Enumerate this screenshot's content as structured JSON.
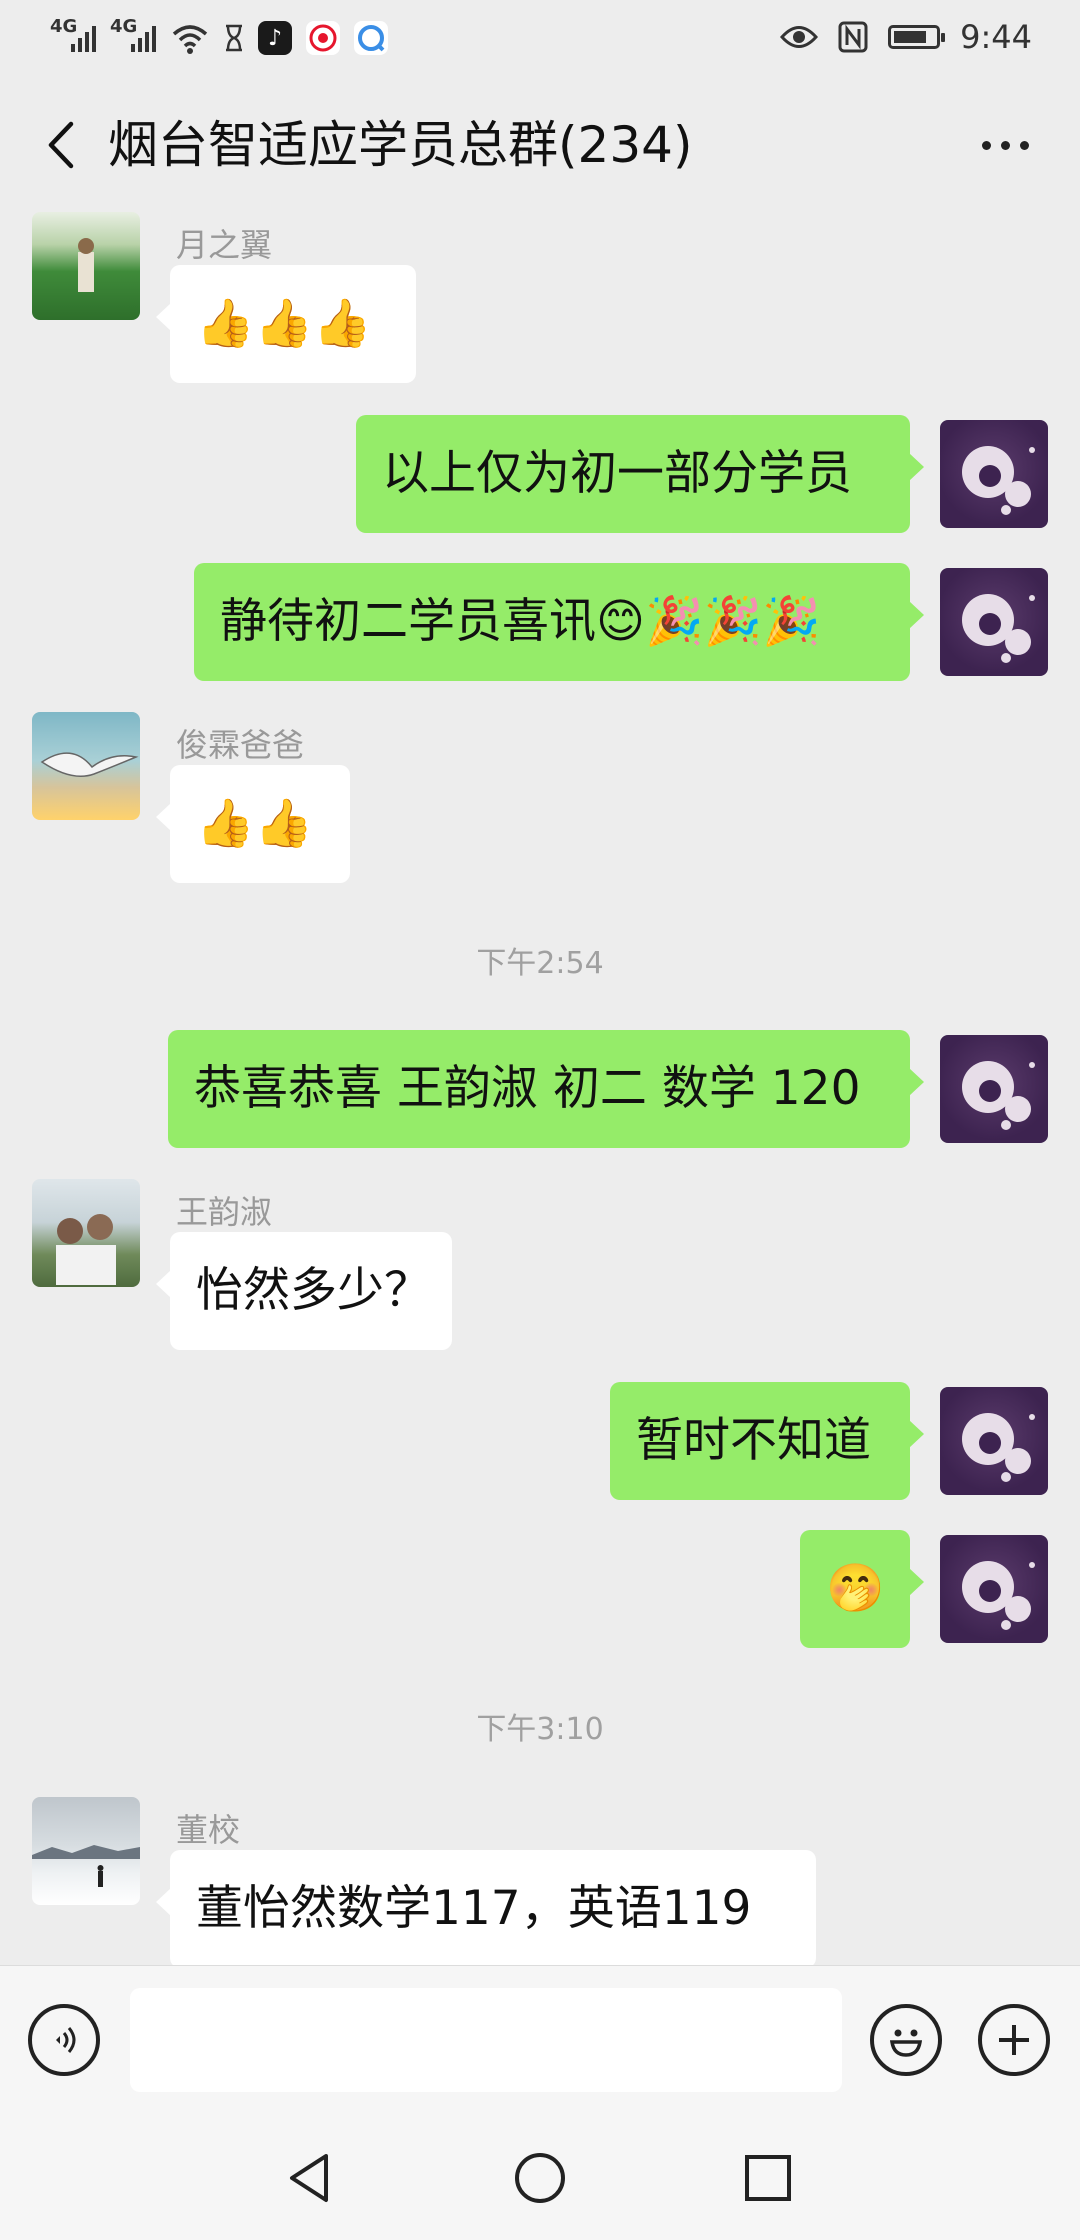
{
  "status_bar": {
    "network_1": "4G",
    "network_2": "4G",
    "time": "9:44",
    "battery_level": 0.8
  },
  "header": {
    "title": "烟台智适应学员总群(234)"
  },
  "messages": [
    {
      "id": "m1",
      "side": "in",
      "sender": "月之翼",
      "avatar": "meadow-photo",
      "text": "👍👍👍"
    },
    {
      "id": "m2",
      "side": "out",
      "text": "以上仅为初一部分学员"
    },
    {
      "id": "m3",
      "side": "out",
      "text": "静待初二学员喜讯😊🎉🎉🎉"
    },
    {
      "id": "m4",
      "side": "in",
      "sender": "俊霖爸爸",
      "avatar": "bird-photo",
      "text": "👍👍"
    },
    {
      "id": "t1",
      "type": "time",
      "text": "下午2:54"
    },
    {
      "id": "m5",
      "side": "out",
      "text": "恭喜恭喜 王韵淑 初二 数学 120"
    },
    {
      "id": "m6",
      "side": "in",
      "sender": "王韵淑",
      "avatar": "selfie-photo",
      "text": "怡然多少？"
    },
    {
      "id": "m7",
      "side": "out",
      "text": "暂时不知道"
    },
    {
      "id": "m8",
      "side": "out",
      "text": "🤭"
    },
    {
      "id": "t2",
      "type": "time",
      "text": "下午3:10"
    },
    {
      "id": "m9",
      "side": "in",
      "sender": "董校",
      "avatar": "snow-photo",
      "text": "董怡然数学117，英语119"
    }
  ],
  "input": {
    "value": "",
    "placeholder": ""
  },
  "colors": {
    "outgoing_bubble": "#95ec69",
    "incoming_bubble": "#ffffff",
    "background": "#ededed"
  }
}
